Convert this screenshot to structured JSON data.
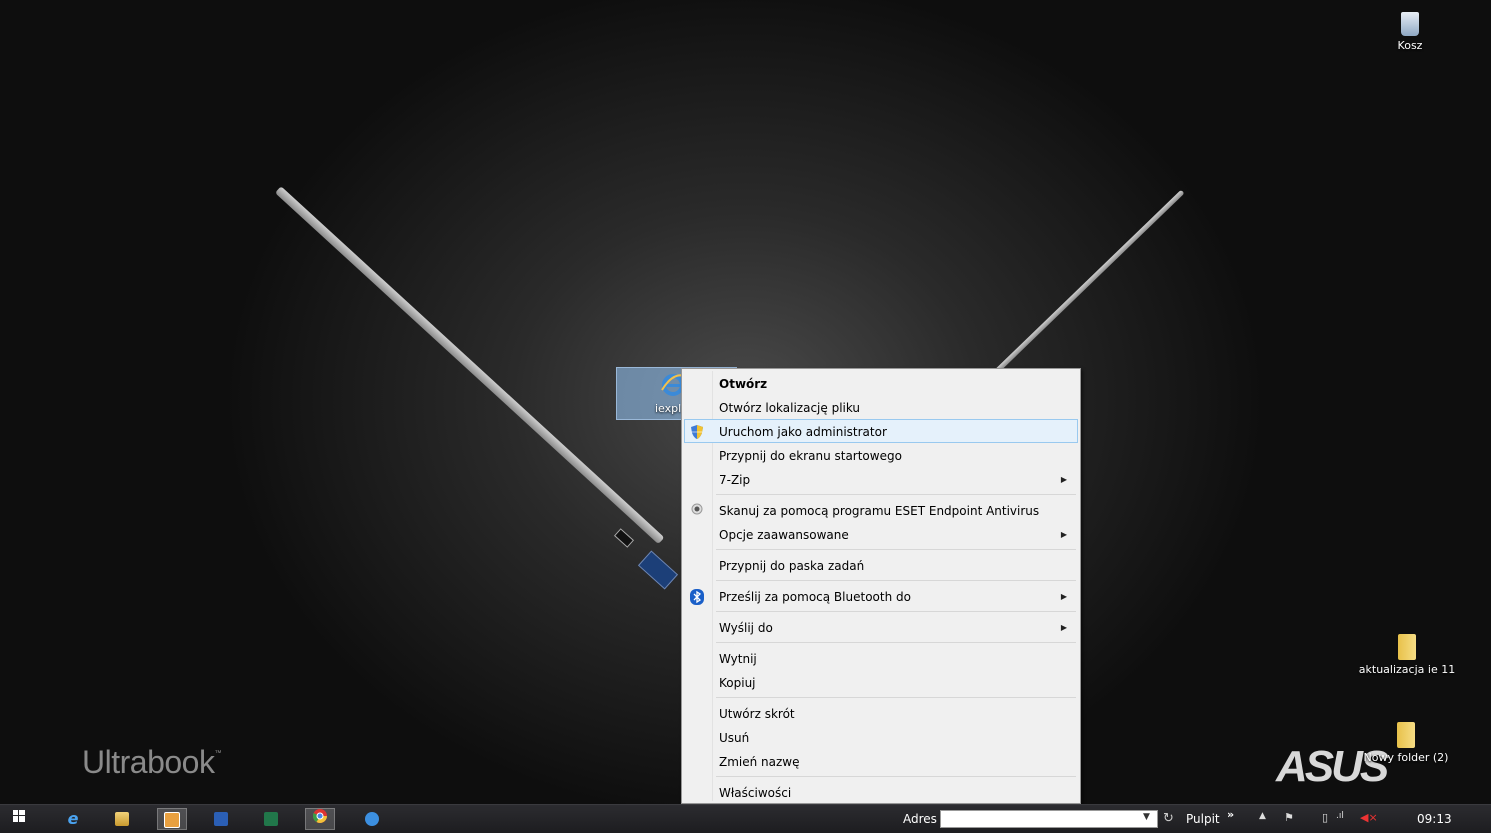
{
  "desktop": {
    "wallpaper_text": "Ultrabook",
    "wallpaper_tm": "™",
    "wallpaper_brand": "ASUS",
    "icons": {
      "recycle_bin": "Kosz",
      "folder_1": "aktualizacja ie 11",
      "folder_2": "Nowy folder (2)",
      "selected": "iexpl"
    }
  },
  "context_menu": {
    "items": [
      {
        "label": "Otwórz"
      },
      {
        "label": "Otwórz lokalizację pliku"
      },
      {
        "label": "Uruchom jako administrator"
      },
      {
        "label": "Przypnij do ekranu startowego"
      },
      {
        "label": "7-Zip"
      },
      {
        "label": "Skanuj za pomocą programu ESET Endpoint Antivirus"
      },
      {
        "label": "Opcje zaawansowane"
      },
      {
        "label": "Przypnij do paska zadań"
      },
      {
        "label": "Prześlij za pomocą Bluetooth do"
      },
      {
        "label": "Wyślij do"
      },
      {
        "label": "Wytnij"
      },
      {
        "label": "Kopiuj"
      },
      {
        "label": "Utwórz skrót"
      },
      {
        "label": "Usuń"
      },
      {
        "label": "Zmień nazwę"
      },
      {
        "label": "Właściwości"
      }
    ]
  },
  "taskbar": {
    "address_label": "Adres",
    "address_value": "",
    "toolbar_label": "Pulpit",
    "toolbar_chevron": "»",
    "clock": "09:13"
  },
  "colors": {
    "menu_bg": "#f0f0f0",
    "menu_hover": "#e5f1fb",
    "selection": "#99ccff",
    "taskbar": "#1d1d20"
  }
}
